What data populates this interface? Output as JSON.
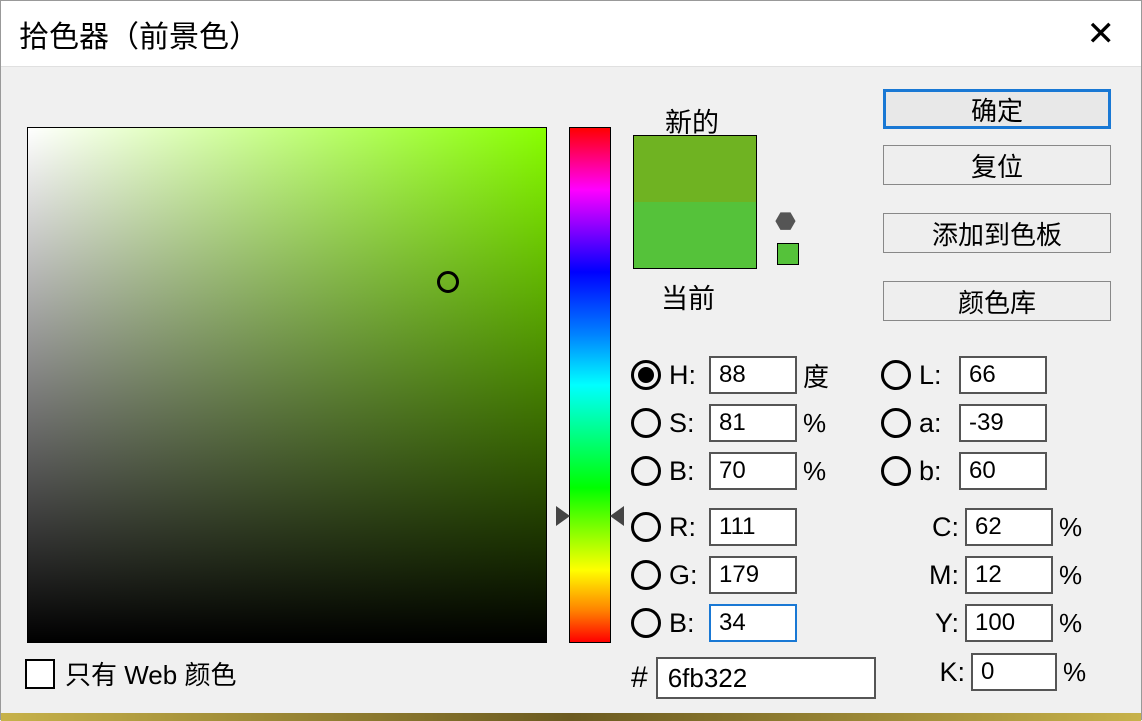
{
  "title": "拾色器（前景色）",
  "close_glyph": "✕",
  "swatch": {
    "new_label": "新的",
    "current_label": "当前",
    "new_color": "#6fb322",
    "current_color": "#55c23a",
    "cube_glyph": "⬣"
  },
  "buttons": {
    "ok": "确定",
    "reset": "复位",
    "add_swatch": "添加到色板",
    "color_lib": "颜色库"
  },
  "fields": {
    "H": {
      "label": "H:",
      "value": "88",
      "unit": "度"
    },
    "S": {
      "label": "S:",
      "value": "81",
      "unit": "%"
    },
    "Bv": {
      "label": "B:",
      "value": "70",
      "unit": "%"
    },
    "R": {
      "label": "R:",
      "value": "111",
      "unit": ""
    },
    "G": {
      "label": "G:",
      "value": "179",
      "unit": ""
    },
    "B": {
      "label": "B:",
      "value": "34",
      "unit": ""
    },
    "L": {
      "label": "L:",
      "value": "66",
      "unit": ""
    },
    "a": {
      "label": "a:",
      "value": "-39",
      "unit": ""
    },
    "b": {
      "label": "b:",
      "value": "60",
      "unit": ""
    },
    "C": {
      "label": "C:",
      "value": "62",
      "unit": "%"
    },
    "M": {
      "label": "M:",
      "value": "12",
      "unit": "%"
    },
    "Y": {
      "label": "Y:",
      "value": "100",
      "unit": "%"
    },
    "K": {
      "label": "K:",
      "value": "0",
      "unit": "%"
    }
  },
  "hex": {
    "label": "#",
    "value": "6fb322"
  },
  "web_only": {
    "label": "只有 Web 颜色"
  },
  "sb_cursor": {
    "x_pct": 81,
    "y_pct": 30
  },
  "hue_marker_pct": 75.5
}
